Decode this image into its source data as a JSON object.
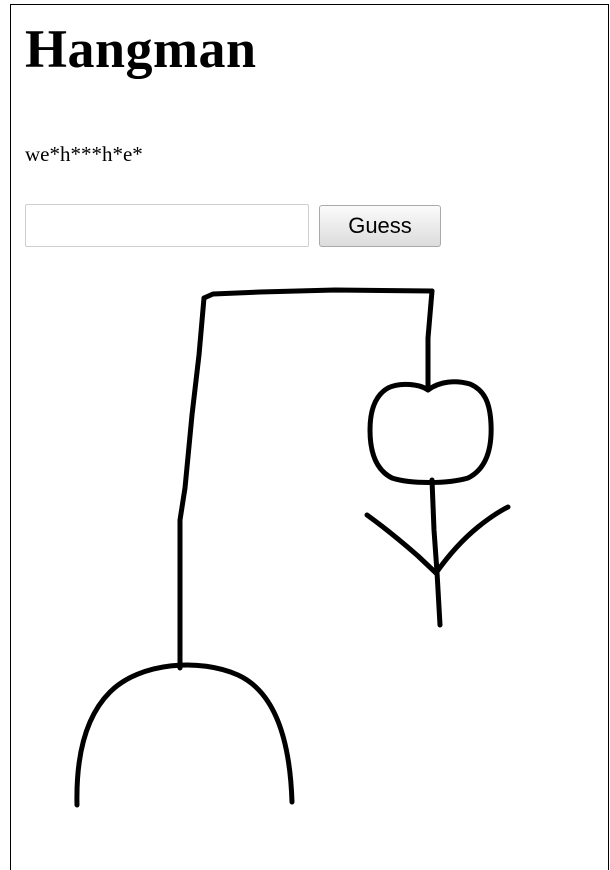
{
  "game": {
    "title": "Hangman",
    "masked_word": "we*h***h*e*",
    "guess_input_value": "",
    "guess_button_label": "Guess"
  },
  "drawing": {
    "parts_shown": [
      "mound",
      "post",
      "beam",
      "rope",
      "head",
      "body",
      "left-arm",
      "right-arm"
    ],
    "stroke_color": "#000000"
  }
}
